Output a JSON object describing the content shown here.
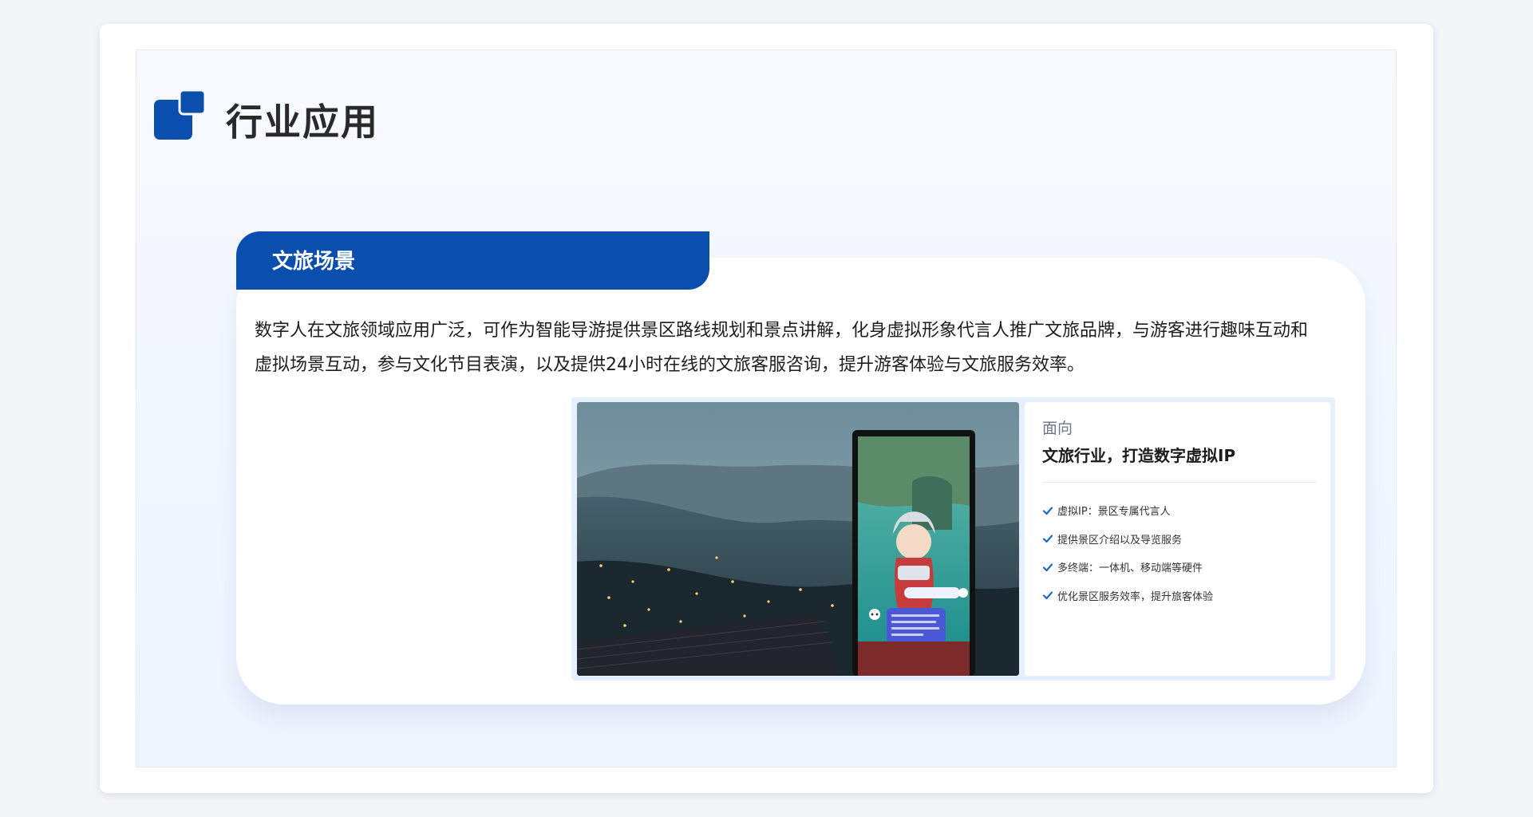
{
  "page": {
    "title": "行业应用"
  },
  "section": {
    "tab_label": "文旅场景",
    "description": "数字人在文旅领域应用广泛，可作为智能导游提供景区路线规划和景点讲解，化身虚拟形象代言人推广文旅品牌，与游客进行趣味互动和虚拟场景互动，参与文化节目表演，以及提供24小时在线的文旅客服咨询，提升游客体验与文旅服务效率。"
  },
  "info_panel": {
    "label": "面向",
    "title": "文旅行业，打造数字虚拟IP",
    "features": [
      "虚拟IP：景区专属代言人",
      "提供景区介绍以及导览服务",
      "多终端：一体机、移动端等硬件",
      "优化景区服务效率，提升旅客体验"
    ]
  },
  "colors": {
    "brand_blue": "#0b4fae",
    "check_blue": "#1e66c8",
    "panel_bg": "#e6efff"
  },
  "icons": [
    "logo-squares-icon",
    "check-icon",
    "robot-avatar-icon",
    "user-avatar-icon"
  ]
}
